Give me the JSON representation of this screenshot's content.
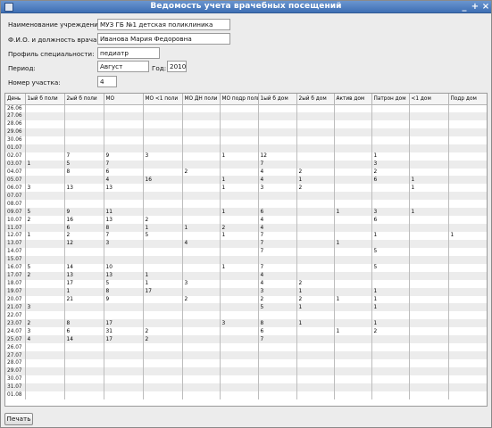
{
  "window": {
    "title": "Ведомость учета врачебных посещений",
    "controls": [
      "_",
      "+",
      "×"
    ]
  },
  "form": {
    "institution_label": "Наименование учреждения:",
    "institution_value": "МУЗ ГБ №1 детская поликлиника",
    "doctor_label": "Ф.И.О. и должность врача:",
    "doctor_value": "Иванова Мария Федоровна",
    "specialty_label": "Профиль специальности:",
    "specialty_value": "педиатр",
    "period_label": "Период:",
    "month_value": "Август",
    "year_label": "Год:",
    "year_value": "2010",
    "district_label": "Номер участка:",
    "district_value": "4"
  },
  "table": {
    "columns": [
      "День",
      "1ый б поли",
      "2ый б поли",
      "МО",
      "МО <1 поли",
      "МО ДН поли",
      "МО подр поли",
      "1ый б дом",
      "2ый б дом",
      "Актив дом",
      "Патрон дом",
      "<1 дом",
      "Подр дом"
    ],
    "rows": [
      [
        "26.06",
        "",
        "",
        "",
        "",
        "",
        "",
        "",
        "",
        "",
        "",
        "",
        ""
      ],
      [
        "27.06",
        "",
        "",
        "",
        "",
        "",
        "",
        "",
        "",
        "",
        "",
        "",
        ""
      ],
      [
        "28.06",
        "",
        "",
        "",
        "",
        "",
        "",
        "",
        "",
        "",
        "",
        "",
        ""
      ],
      [
        "29.06",
        "",
        "",
        "",
        "",
        "",
        "",
        "",
        "",
        "",
        "",
        "",
        ""
      ],
      [
        "30.06",
        "",
        "",
        "",
        "",
        "",
        "",
        "",
        "",
        "",
        "",
        "",
        ""
      ],
      [
        "01.07",
        "",
        "",
        "",
        "",
        "",
        "",
        "",
        "",
        "",
        "",
        "",
        ""
      ],
      [
        "02.07",
        "",
        "7",
        "9",
        "3",
        "",
        "1",
        "12",
        "",
        "",
        "1",
        "",
        ""
      ],
      [
        "03.07",
        "1",
        "5",
        "7",
        "",
        "",
        "",
        "7",
        "",
        "",
        "3",
        "",
        ""
      ],
      [
        "04.07",
        "",
        "8",
        "6",
        "",
        "2",
        "",
        "4",
        "2",
        "",
        "2",
        "",
        ""
      ],
      [
        "05.07",
        "",
        "",
        "4",
        "16",
        "",
        "1",
        "4",
        "1",
        "",
        "6",
        "1",
        ""
      ],
      [
        "06.07",
        "3",
        "13",
        "13",
        "",
        "",
        "1",
        "3",
        "2",
        "",
        "",
        "1",
        ""
      ],
      [
        "07.07",
        "",
        "",
        "",
        "",
        "",
        "",
        "",
        "",
        "",
        "",
        "",
        ""
      ],
      [
        "08.07",
        "",
        "",
        "",
        "",
        "",
        "",
        "",
        "",
        "",
        "",
        "",
        ""
      ],
      [
        "09.07",
        "5",
        "9",
        "11",
        "",
        "",
        "1",
        "6",
        "",
        "1",
        "3",
        "1",
        ""
      ],
      [
        "10.07",
        "2",
        "16",
        "13",
        "2",
        "",
        "",
        "4",
        "",
        "",
        "6",
        "",
        ""
      ],
      [
        "11.07",
        "",
        "6",
        "8",
        "1",
        "1",
        "2",
        "4",
        "",
        "",
        "",
        "",
        ""
      ],
      [
        "12.07",
        "1",
        "2",
        "7",
        "5",
        "",
        "1",
        "7",
        "",
        "",
        "1",
        "",
        "1"
      ],
      [
        "13.07",
        "",
        "12",
        "3",
        "",
        "4",
        "",
        "7",
        "",
        "1",
        "",
        "",
        ""
      ],
      [
        "14.07",
        "",
        "",
        "",
        "",
        "",
        "",
        "7",
        "",
        "",
        "5",
        "",
        ""
      ],
      [
        "15.07",
        "",
        "",
        "",
        "",
        "",
        "",
        "",
        "",
        "",
        "",
        "",
        ""
      ],
      [
        "16.07",
        "5",
        "14",
        "10",
        "",
        "",
        "1",
        "7",
        "",
        "",
        "5",
        "",
        ""
      ],
      [
        "17.07",
        "2",
        "13",
        "13",
        "1",
        "",
        "",
        "4",
        "",
        "",
        "",
        "",
        ""
      ],
      [
        "18.07",
        "",
        "17",
        "5",
        "1",
        "3",
        "",
        "4",
        "2",
        "",
        "",
        "",
        ""
      ],
      [
        "19.07",
        "",
        "1",
        "8",
        "17",
        "",
        "",
        "3",
        "1",
        "",
        "1",
        "",
        ""
      ],
      [
        "20.07",
        "",
        "21",
        "9",
        "",
        "2",
        "",
        "2",
        "2",
        "1",
        "1",
        "",
        ""
      ],
      [
        "21.07",
        "3",
        "",
        "",
        "",
        "",
        "",
        "5",
        "1",
        "",
        "1",
        "",
        ""
      ],
      [
        "22.07",
        "",
        "",
        "",
        "",
        "",
        "",
        "",
        "",
        "",
        "",
        "",
        ""
      ],
      [
        "23.07",
        "2",
        "8",
        "17",
        "",
        "",
        "3",
        "8",
        "1",
        "",
        "1",
        "",
        ""
      ],
      [
        "24.07",
        "3",
        "6",
        "31",
        "2",
        "",
        "",
        "6",
        "",
        "1",
        "2",
        "",
        ""
      ],
      [
        "25.07",
        "4",
        "14",
        "17",
        "2",
        "",
        "",
        "7",
        "",
        "",
        "",
        "",
        ""
      ],
      [
        "26.07",
        "",
        "",
        "",
        "",
        "",
        "",
        "",
        "",
        "",
        "",
        "",
        ""
      ],
      [
        "27.07",
        "",
        "",
        "",
        "",
        "",
        "",
        "",
        "",
        "",
        "",
        "",
        ""
      ],
      [
        "28.07",
        "",
        "",
        "",
        "",
        "",
        "",
        "",
        "",
        "",
        "",
        "",
        ""
      ],
      [
        "29.07",
        "",
        "",
        "",
        "",
        "",
        "",
        "",
        "",
        "",
        "",
        "",
        ""
      ],
      [
        "30.07",
        "",
        "",
        "",
        "",
        "",
        "",
        "",
        "",
        "",
        "",
        "",
        ""
      ],
      [
        "31.07",
        "",
        "",
        "",
        "",
        "",
        "",
        "",
        "",
        "",
        "",
        "",
        ""
      ],
      [
        "01.08",
        "",
        "",
        "",
        "",
        "",
        "",
        "",
        "",
        "",
        "",
        "",
        ""
      ]
    ]
  },
  "buttons": {
    "print_label": "Печать"
  }
}
